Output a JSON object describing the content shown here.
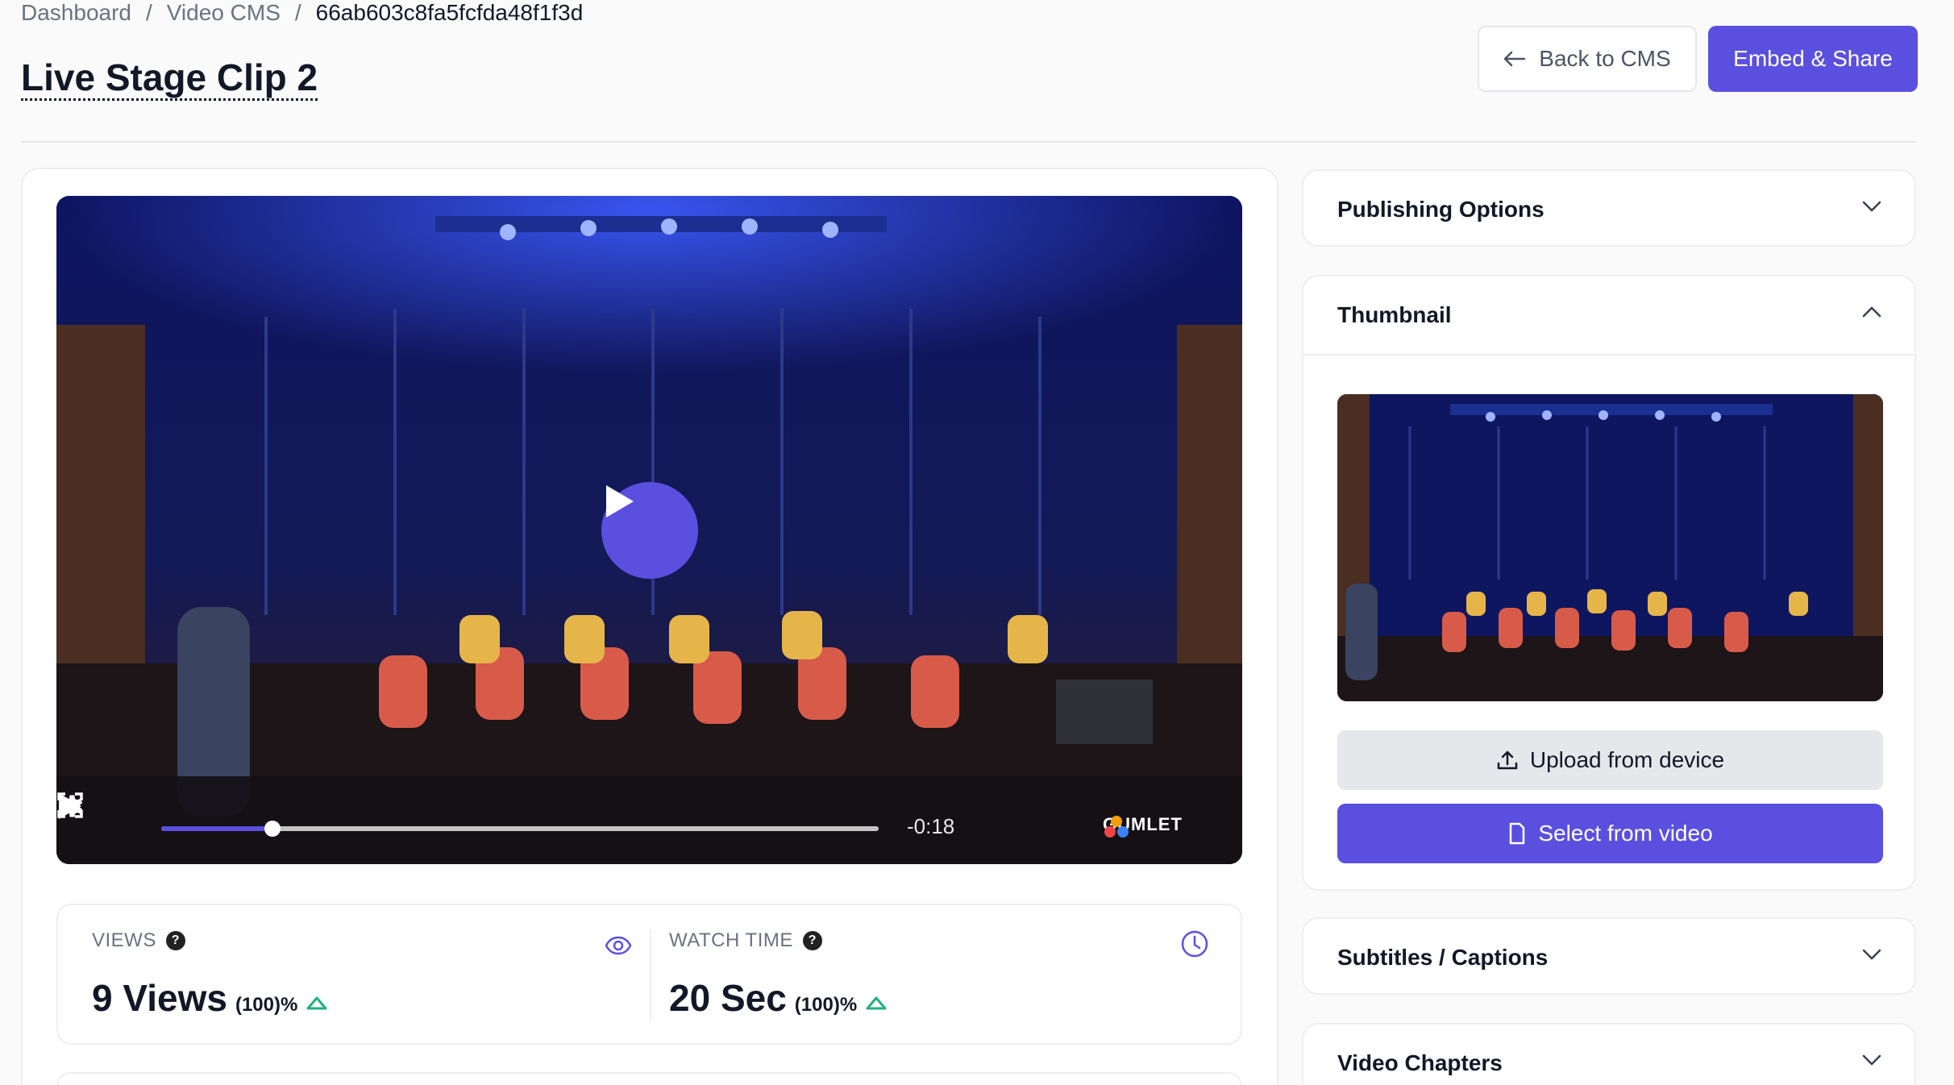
{
  "breadcrumb": {
    "items": [
      "Dashboard",
      "Video CMS",
      "66ab603c8fa5fcfda48f1f3d"
    ],
    "separator": "/"
  },
  "page": {
    "title": "Live Stage Clip 2"
  },
  "header": {
    "back_label": "Back to CMS",
    "embed_label": "Embed & Share"
  },
  "player": {
    "time_remaining": "-0:18",
    "brand": "GUMLET",
    "progress_fraction": 0.155
  },
  "stats": {
    "views": {
      "label": "VIEWS",
      "help": "?",
      "value": "9 Views",
      "change": "(100)%"
    },
    "watch_time": {
      "label": "WATCH TIME",
      "help": "?",
      "value": "20 Sec",
      "change": "(100)%"
    }
  },
  "sidebar": {
    "publishing": {
      "title": "Publishing Options"
    },
    "thumbnail": {
      "title": "Thumbnail",
      "upload_label": "Upload from device",
      "select_label": "Select from video"
    },
    "subtitles": {
      "title": "Subtitles / Captions"
    },
    "chapters": {
      "title": "Video Chapters"
    }
  },
  "colors": {
    "accent": "#5b4fe0",
    "positive": "#22b07d",
    "muted": "#6b7280"
  },
  "icons": [
    "arrow-left-icon",
    "play-icon",
    "gear-icon",
    "fullscreen-icon",
    "eye-icon",
    "clock-icon",
    "chevron-down-icon",
    "chevron-up-icon",
    "upload-icon",
    "frame-icon",
    "help-icon",
    "trend-up-icon"
  ]
}
